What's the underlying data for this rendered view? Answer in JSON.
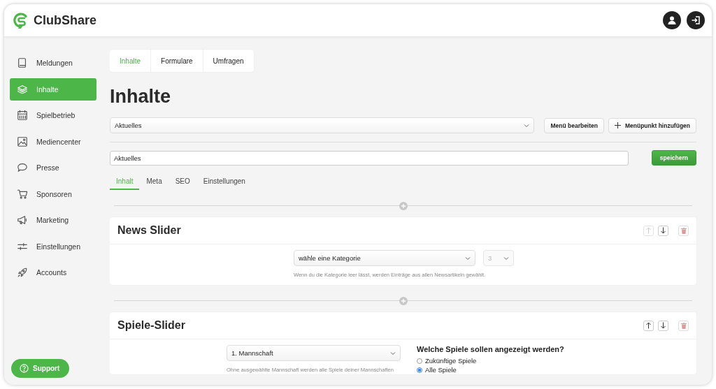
{
  "app": {
    "name": "ClubShare"
  },
  "sidebar": {
    "items": [
      {
        "label": "Meldungen",
        "selected": false
      },
      {
        "label": "Inhalte",
        "selected": true
      },
      {
        "label": "Spielbetrieb",
        "selected": false
      },
      {
        "label": "Mediencenter",
        "selected": false
      },
      {
        "label": "Presse",
        "selected": false
      },
      {
        "label": "Sponsoren",
        "selected": false
      },
      {
        "label": "Marketing",
        "selected": false
      },
      {
        "label": "Einstellungen",
        "selected": false
      },
      {
        "label": "Accounts",
        "selected": false
      }
    ],
    "support_button": "Support"
  },
  "top_tabs": [
    {
      "label": "Inhalte",
      "selected": true
    },
    {
      "label": "Formulare",
      "selected": false
    },
    {
      "label": "Umfragen",
      "selected": false
    }
  ],
  "page_title": "Inhalte",
  "menu_select": {
    "value": "Aktuelles"
  },
  "menu_buttons": [
    {
      "label": "Menü bearbeiten",
      "kind": "plain"
    },
    {
      "label": "Menüpunkt hinzufügen",
      "kind": "add"
    }
  ],
  "title_field": {
    "value": "Aktuelles"
  },
  "save_button": "speichern",
  "content_tabs": [
    {
      "label": "Inhalt",
      "selected": true
    },
    {
      "label": "Meta",
      "selected": false
    },
    {
      "label": "SEO",
      "selected": false
    },
    {
      "label": "Einstellungen",
      "selected": false
    }
  ],
  "blocks": [
    {
      "kind": "news",
      "title": "News Slider",
      "move_up_disabled": true,
      "move_down_disabled": false,
      "category_select": {
        "value": "wähle eine Kategorie"
      },
      "count_select": {
        "value": "3",
        "disabled": true
      },
      "hint": "Wenn du die Kategorie leer lässt, werden Einträge aus allen Newsartikeln gewählt."
    },
    {
      "kind": "games",
      "title": "Spiele-Slider",
      "move_up_disabled": false,
      "move_down_disabled": false,
      "team_select": {
        "value": "1. Mannschaft"
      },
      "hint": "Ohne ausgewählte Mannschaft werden alle Spiele deiner Mannschaften",
      "question": "Welche Spiele sollen angezeigt werden?",
      "options": [
        {
          "label": "Zukünftige Spiele",
          "selected": false
        },
        {
          "label": "Alle Spiele",
          "selected": true
        }
      ]
    }
  ]
}
